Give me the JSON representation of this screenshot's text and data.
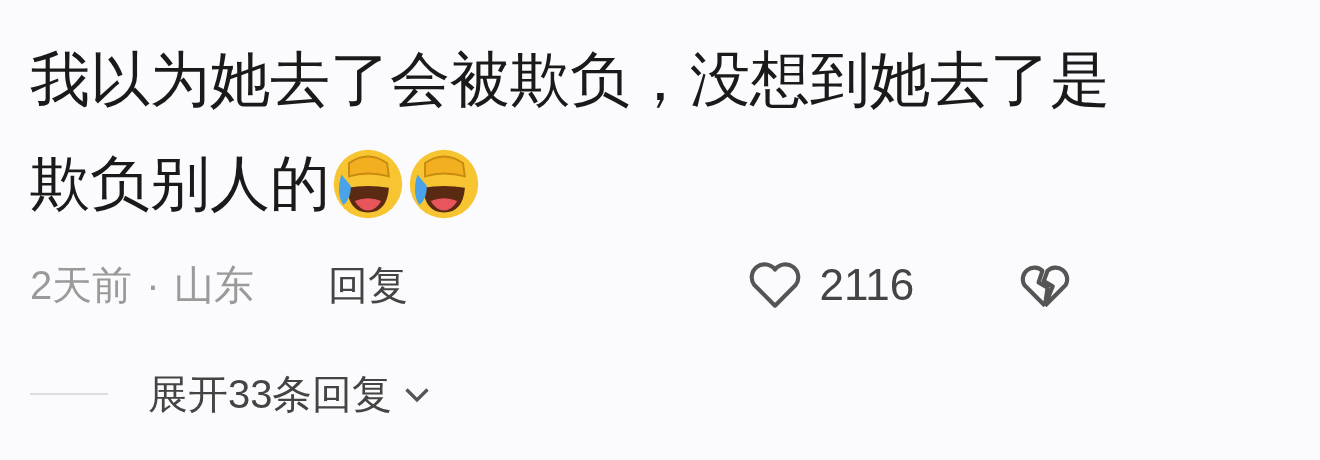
{
  "comment": {
    "text_lines": [
      "我以为她去了会被欺负，没想到她去了是",
      "欺负别人的"
    ],
    "time": "2天前",
    "separator": "·",
    "location": "山东",
    "reply_label": "回复",
    "like_count": "2116",
    "expand_replies": "展开33条回复"
  }
}
